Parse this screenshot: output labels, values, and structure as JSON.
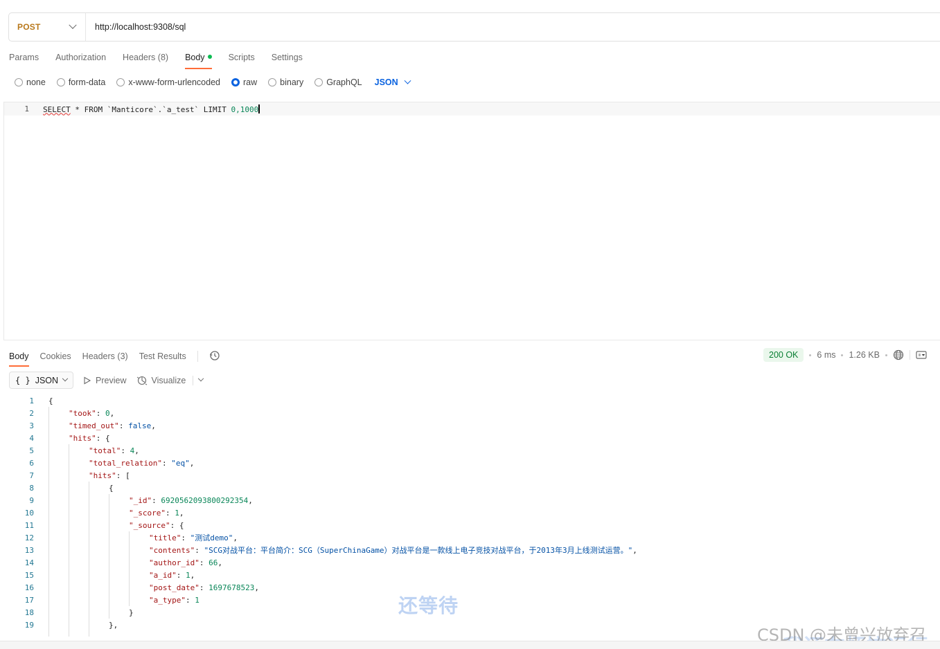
{
  "request": {
    "method": "POST",
    "url": "http://localhost:9308/sql"
  },
  "request_tabs": [
    {
      "label": "Params"
    },
    {
      "label": "Authorization"
    },
    {
      "label": "Headers",
      "count": "(8)"
    },
    {
      "label": "Body"
    },
    {
      "label": "Scripts"
    },
    {
      "label": "Settings"
    }
  ],
  "body_types": [
    "none",
    "form-data",
    "x-www-form-urlencoded",
    "raw",
    "binary",
    "GraphQL"
  ],
  "body_format": "JSON",
  "editor": {
    "line_number": "1",
    "code_kw": "SELECT",
    "code_mid": " * FROM `Manticore`.`a_test` LIMIT ",
    "code_num": "0,1000"
  },
  "response_tabs": [
    {
      "label": "Body"
    },
    {
      "label": "Cookies"
    },
    {
      "label": "Headers",
      "count": "(3)"
    },
    {
      "label": "Test Results"
    }
  ],
  "response_meta": {
    "status": "200 OK",
    "time": "6 ms",
    "size": "1.26 KB"
  },
  "view_controls": {
    "format": "JSON",
    "preview": "Preview",
    "visualize": "Visualize"
  },
  "response_lines": [
    {
      "n": "1",
      "indent": 0,
      "parts": [
        [
          "p",
          "{"
        ]
      ]
    },
    {
      "n": "2",
      "indent": 1,
      "parts": [
        [
          "k",
          "\"took\""
        ],
        [
          "p",
          ": "
        ],
        [
          "n",
          "0"
        ],
        [
          "p",
          ","
        ]
      ]
    },
    {
      "n": "3",
      "indent": 1,
      "parts": [
        [
          "k",
          "\"timed_out\""
        ],
        [
          "p",
          ": "
        ],
        [
          "b",
          "false"
        ],
        [
          "p",
          ","
        ]
      ]
    },
    {
      "n": "4",
      "indent": 1,
      "parts": [
        [
          "k",
          "\"hits\""
        ],
        [
          "p",
          ": {"
        ]
      ]
    },
    {
      "n": "5",
      "indent": 2,
      "parts": [
        [
          "k",
          "\"total\""
        ],
        [
          "p",
          ": "
        ],
        [
          "n",
          "4"
        ],
        [
          "p",
          ","
        ]
      ]
    },
    {
      "n": "6",
      "indent": 2,
      "parts": [
        [
          "k",
          "\"total_relation\""
        ],
        [
          "p",
          ": "
        ],
        [
          "s",
          "\"eq\""
        ],
        [
          "p",
          ","
        ]
      ]
    },
    {
      "n": "7",
      "indent": 2,
      "parts": [
        [
          "k",
          "\"hits\""
        ],
        [
          "p",
          ": ["
        ]
      ]
    },
    {
      "n": "8",
      "indent": 3,
      "parts": [
        [
          "p",
          "{"
        ]
      ]
    },
    {
      "n": "9",
      "indent": 4,
      "parts": [
        [
          "k",
          "\"_id\""
        ],
        [
          "p",
          ": "
        ],
        [
          "n",
          "6920562093800292354"
        ],
        [
          "p",
          ","
        ]
      ]
    },
    {
      "n": "10",
      "indent": 4,
      "parts": [
        [
          "k",
          "\"_score\""
        ],
        [
          "p",
          ": "
        ],
        [
          "n",
          "1"
        ],
        [
          "p",
          ","
        ]
      ]
    },
    {
      "n": "11",
      "indent": 4,
      "parts": [
        [
          "k",
          "\"_source\""
        ],
        [
          "p",
          ": {"
        ]
      ]
    },
    {
      "n": "12",
      "indent": 5,
      "parts": [
        [
          "k",
          "\"title\""
        ],
        [
          "p",
          ": "
        ],
        [
          "s",
          "\"测试demo\""
        ],
        [
          "p",
          ","
        ]
      ]
    },
    {
      "n": "13",
      "indent": 5,
      "parts": [
        [
          "k",
          "\"contents\""
        ],
        [
          "p",
          ": "
        ],
        [
          "s",
          "\"SCG对战平台：平台简介：SCG（SuperChinaGame）对战平台是一款线上电子竞技对战平台，于2013年3月上线测试运营。\""
        ],
        [
          "p",
          ","
        ]
      ]
    },
    {
      "n": "14",
      "indent": 5,
      "parts": [
        [
          "k",
          "\"author_id\""
        ],
        [
          "p",
          ": "
        ],
        [
          "n",
          "66"
        ],
        [
          "p",
          ","
        ]
      ]
    },
    {
      "n": "15",
      "indent": 5,
      "parts": [
        [
          "k",
          "\"a_id\""
        ],
        [
          "p",
          ": "
        ],
        [
          "n",
          "1"
        ],
        [
          "p",
          ","
        ]
      ]
    },
    {
      "n": "16",
      "indent": 5,
      "parts": [
        [
          "k",
          "\"post_date\""
        ],
        [
          "p",
          ": "
        ],
        [
          "n",
          "1697678523"
        ],
        [
          "p",
          ","
        ]
      ]
    },
    {
      "n": "17",
      "indent": 5,
      "parts": [
        [
          "k",
          "\"a_type\""
        ],
        [
          "p",
          ": "
        ],
        [
          "n",
          "1"
        ]
      ]
    },
    {
      "n": "18",
      "indent": 4,
      "parts": [
        [
          "p",
          "}"
        ]
      ]
    },
    {
      "n": "19",
      "indent": 3,
      "parts": [
        [
          "p",
          "},"
        ]
      ]
    }
  ],
  "watermarks": {
    "center": "还等待",
    "csdn": "CSDN @未曾兴放弃召",
    "bottom": "我还在烦恼运行"
  }
}
